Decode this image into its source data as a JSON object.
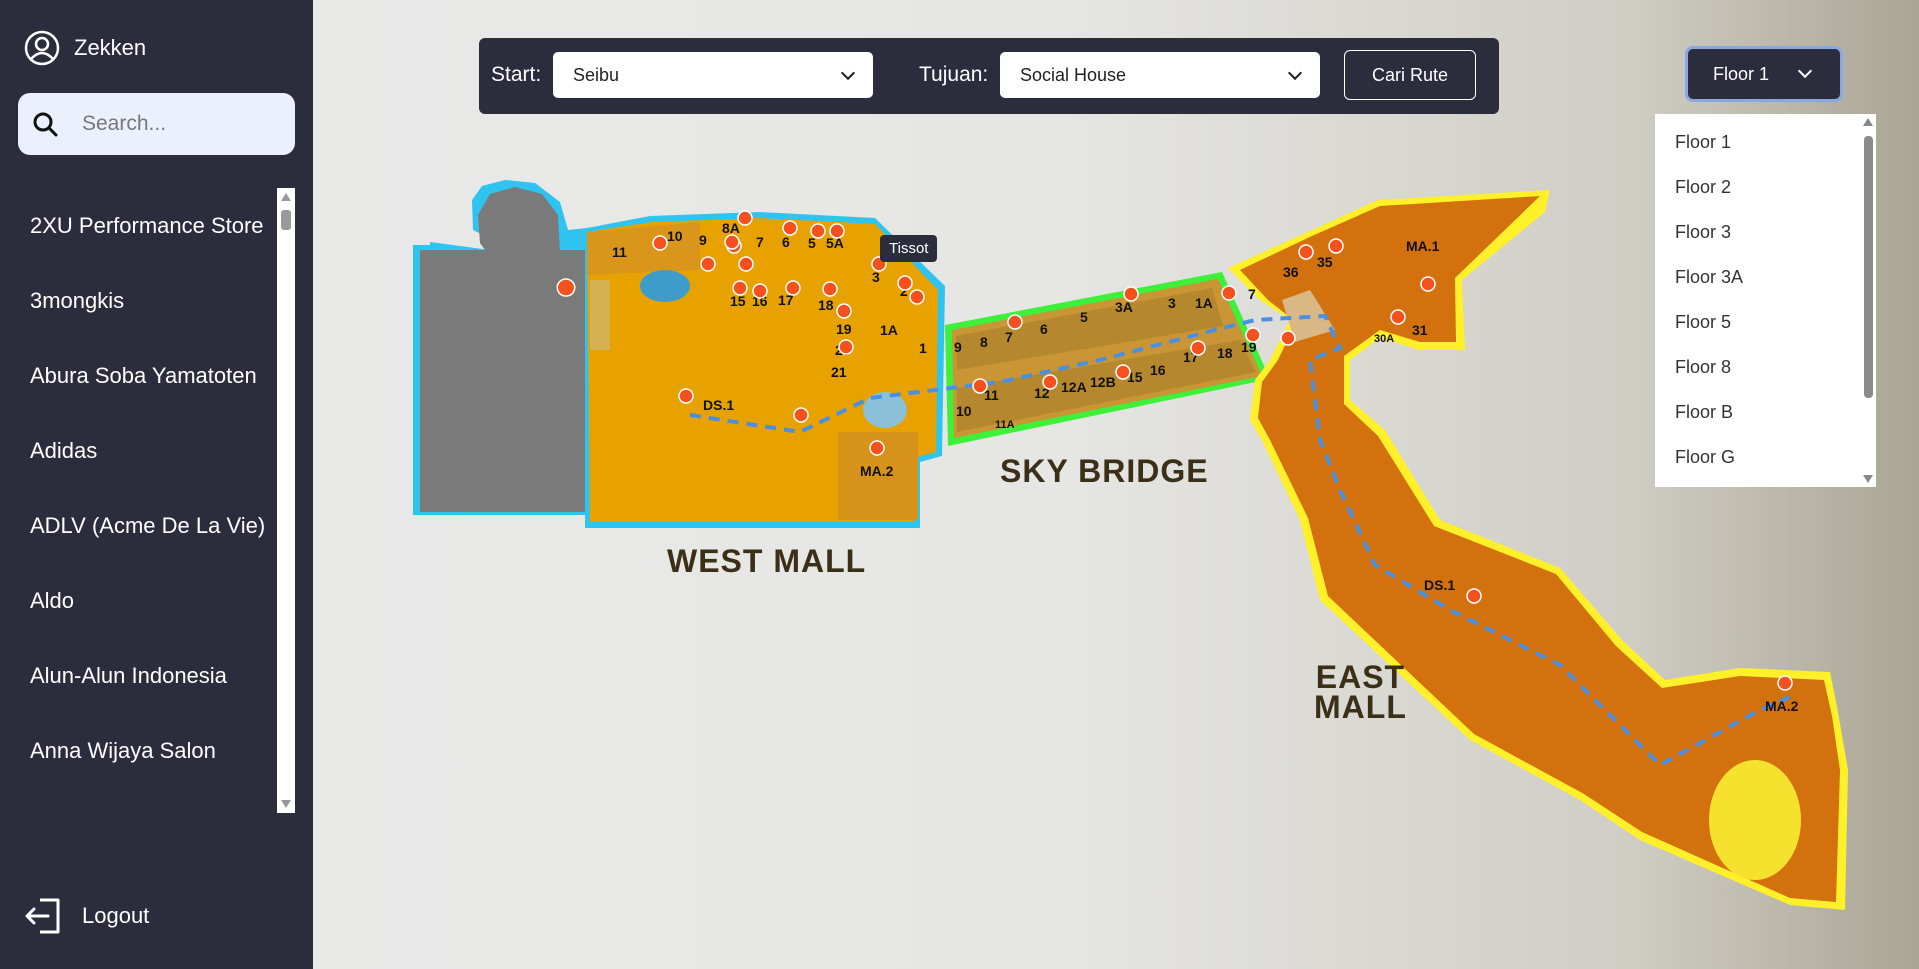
{
  "user": {
    "name": "Zekken"
  },
  "search": {
    "placeholder": "Search..."
  },
  "stores": [
    "2XU Performance Store",
    "3mongkis",
    "Abura Soba Yamatoten",
    "Adidas",
    "ADLV (Acme De La Vie)",
    "Aldo",
    "Alun-Alun Indonesia",
    "Anna Wijaya Salon"
  ],
  "logout": {
    "label": "Logout"
  },
  "route": {
    "start_label": "Start:",
    "start_value": "Seibu",
    "dest_label": "Tujuan:",
    "dest_value": "Social House",
    "button": "Cari Rute"
  },
  "floor": {
    "selected": "Floor 1",
    "options": [
      "Floor 1",
      "Floor 2",
      "Floor 3",
      "Floor 3A",
      "Floor 5",
      "Floor 8",
      "Floor B",
      "Floor G"
    ]
  },
  "map": {
    "zones": {
      "west": "WEST MALL",
      "sky": "SKY BRIDGE",
      "east_1": "EAST",
      "east_2": "MALL"
    },
    "tooltip": "Tissot",
    "west_units": [
      "11",
      "10",
      "9",
      "8A",
      "7",
      "6",
      "5",
      "5A",
      "3",
      "2",
      "1A",
      "1",
      "15",
      "16",
      "17",
      "18",
      "19",
      "20",
      "21",
      "DS.1",
      "MA.2"
    ],
    "sky_units": [
      "9",
      "8",
      "7",
      "6",
      "5",
      "3A",
      "3",
      "1A",
      "10",
      "11",
      "11A",
      "12",
      "12A",
      "12B",
      "15",
      "16",
      "17",
      "18",
      "19"
    ],
    "east_units": [
      "7",
      "36",
      "35",
      "MA.1",
      "30A",
      "31",
      "DS.1",
      "MA.2"
    ]
  },
  "colors": {
    "sidebar": "#2b2d3d",
    "west": "#e8a200",
    "sky": "#c99535",
    "east": "#d2710d",
    "pin": "#f4511e",
    "route": "#4a90e2"
  }
}
